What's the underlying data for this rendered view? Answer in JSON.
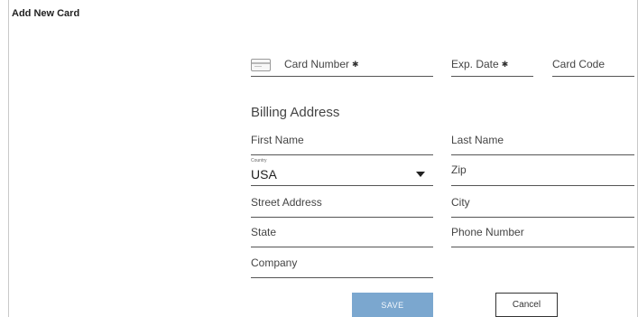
{
  "dialog": {
    "title": "Add New Card"
  },
  "card": {
    "number_label": "Card Number",
    "exp_label": "Exp. Date",
    "code_label": "Card Code",
    "required_mark": "✱"
  },
  "billing": {
    "section_title": "Billing Address",
    "first_name_label": "First Name",
    "last_name_label": "Last Name",
    "country_label": "Country",
    "country_value": "USA",
    "zip_label": "Zip",
    "street_label": "Street Address",
    "city_label": "City",
    "state_label": "State",
    "phone_label": "Phone Number",
    "company_label": "Company"
  },
  "actions": {
    "save_label": "SAVE",
    "cancel_label": "Cancel"
  },
  "colors": {
    "save_button": "#7ba7cf"
  }
}
